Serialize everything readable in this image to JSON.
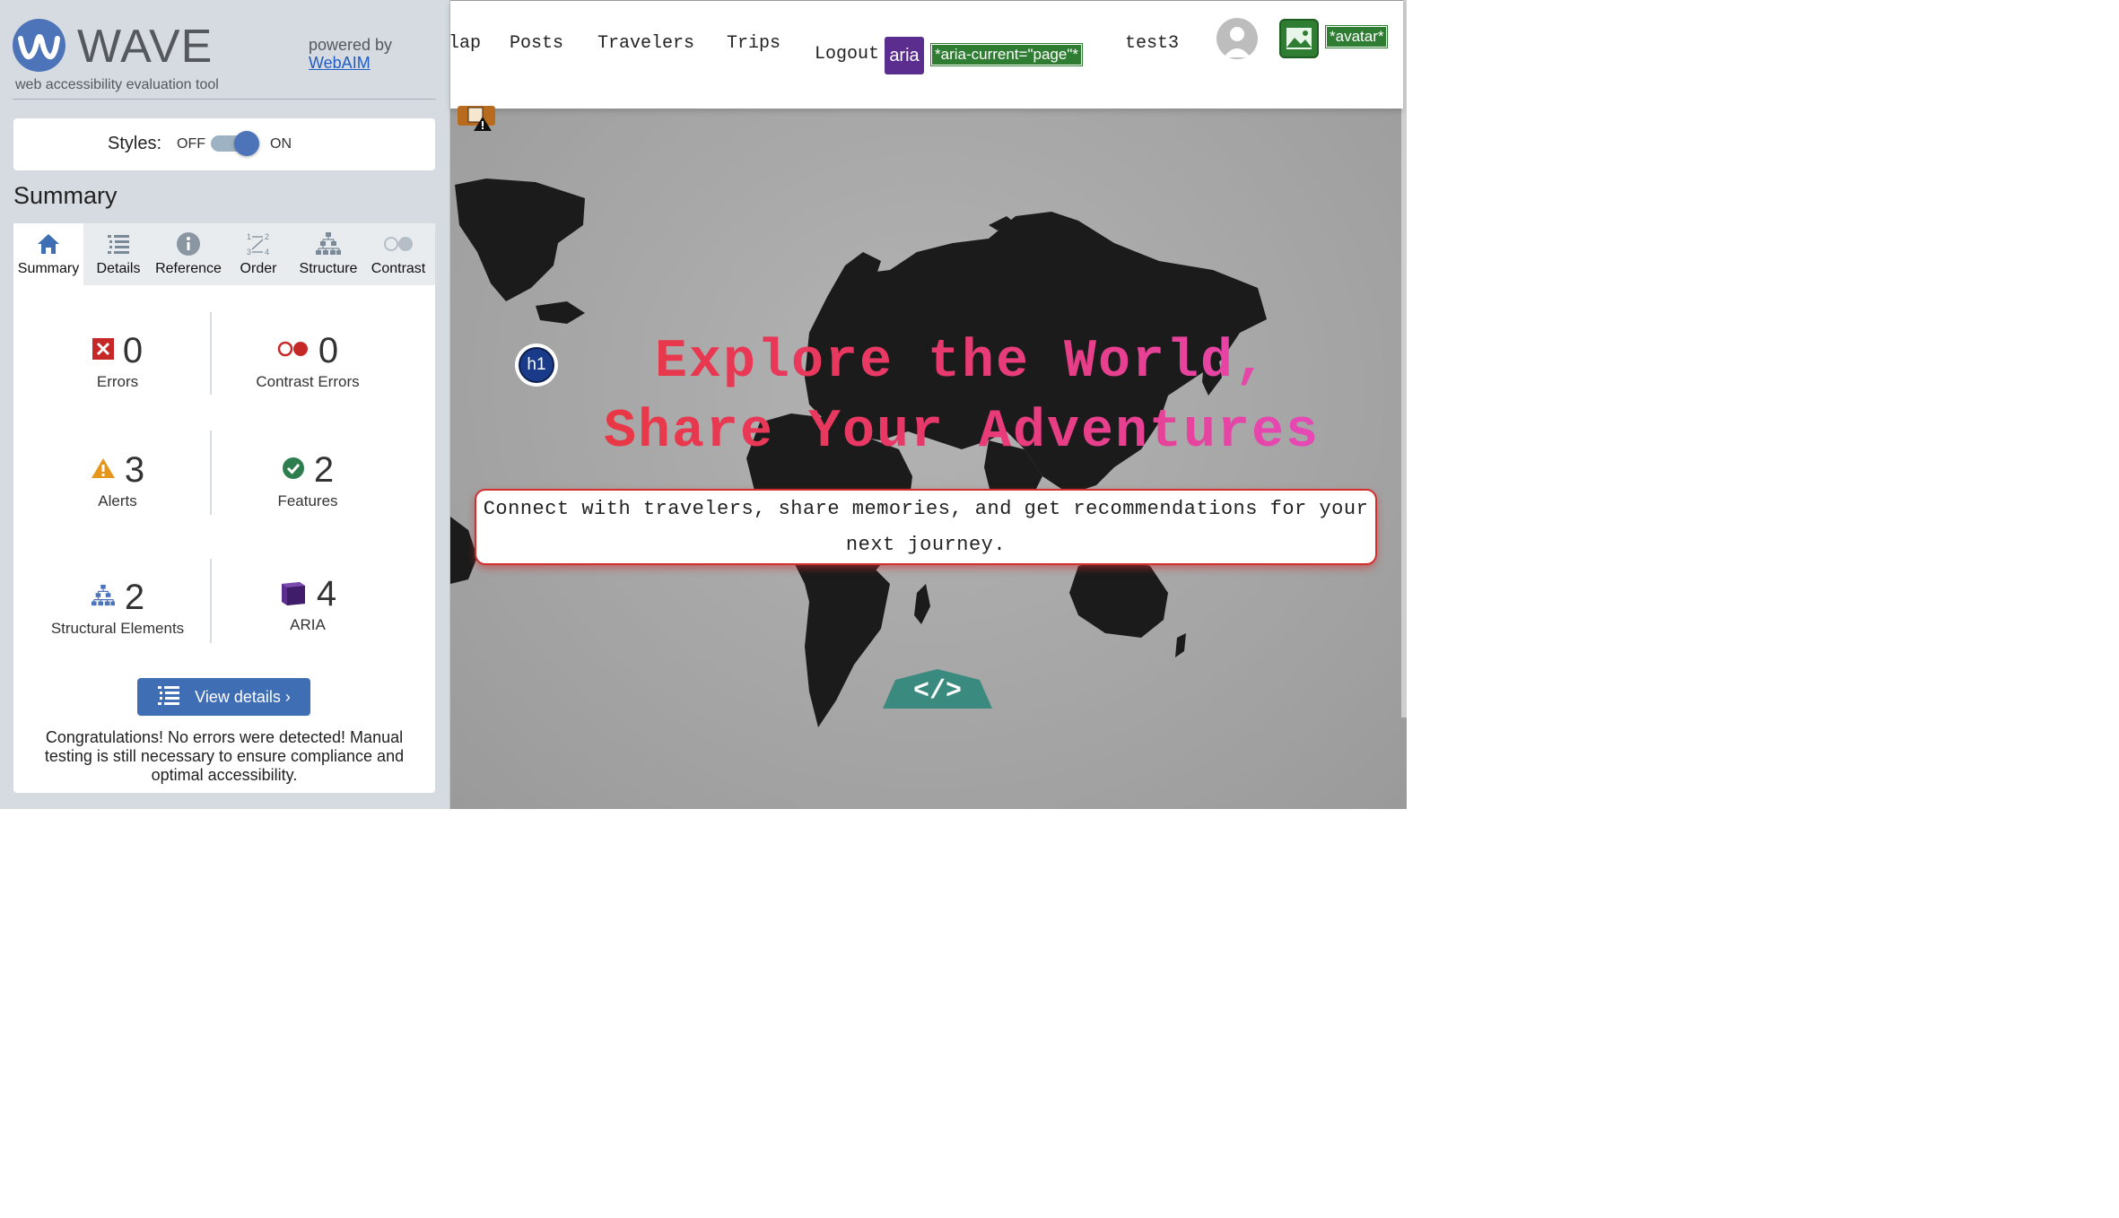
{
  "wave": {
    "wordmark": "WAVE",
    "tagline": "web accessibility evaluation tool",
    "powered_by": "powered by",
    "webaim_link": "WebAIM",
    "styles": {
      "label": "Styles:",
      "off": "OFF",
      "on": "ON",
      "state": "on"
    },
    "summary_heading": "Summary",
    "tabs": [
      {
        "label": "Summary",
        "icon": "home-icon",
        "active": true
      },
      {
        "label": "Details",
        "icon": "list-icon"
      },
      {
        "label": "Reference",
        "icon": "info-icon"
      },
      {
        "label": "Order",
        "icon": "order-icon"
      },
      {
        "label": "Structure",
        "icon": "structure-icon"
      },
      {
        "label": "Contrast",
        "icon": "contrast-icon"
      }
    ],
    "stats": {
      "errors": {
        "count": "0",
        "label": "Errors",
        "icon": "error-icon",
        "color": "#c62828"
      },
      "contrast_errors": {
        "count": "0",
        "label": "Contrast Errors",
        "icon": "contrast-error-icon",
        "color": "#c62828"
      },
      "alerts": {
        "count": "3",
        "label": "Alerts",
        "icon": "alert-icon",
        "color": "#e6961a"
      },
      "features": {
        "count": "2",
        "label": "Features",
        "icon": "feature-check-icon",
        "color": "#2e7d4f"
      },
      "structural": {
        "count": "2",
        "label": "Structural Elements",
        "icon": "structure-icon",
        "color": "#4d74b8"
      },
      "aria": {
        "count": "4",
        "label": "ARIA",
        "icon": "aria-cube-icon",
        "color": "#5b2d8e"
      }
    },
    "view_details_label": "View details ›",
    "congrats": "Congratulations! No errors were detected! Manual testing is still necessary to ensure compliance and optimal accessibility."
  },
  "site": {
    "nav": {
      "map": "lap",
      "posts": "Posts",
      "travelers": "Travelers",
      "trips": "Trips",
      "logout": "Logout",
      "user": "test3"
    },
    "aria_badge": "aria",
    "aria_current_label": "*aria-current=\"page\"*",
    "avatar_label": "*avatar*",
    "h1_badge": "h1",
    "hero_title": "Explore the World, Share Your Adventures",
    "hero_subtitle": "Connect with travelers, share memories, and get recommendations for your next journey.",
    "code_badge": "</>"
  },
  "colors": {
    "wave_blue": "#4d74b8",
    "aria_purple": "#5b2d8e",
    "aria_green": "#2e7d32",
    "hero_title_red": "#e8383f",
    "hero_title_pink": "#e64ac0"
  }
}
